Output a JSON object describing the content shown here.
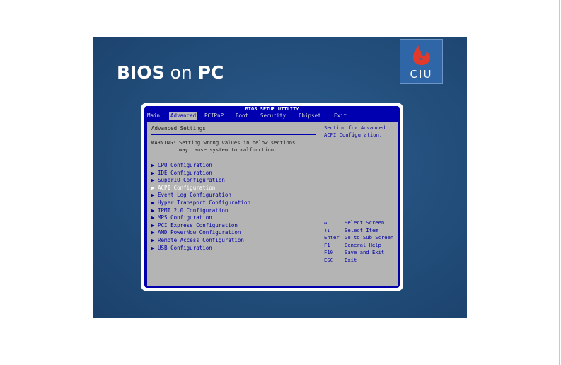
{
  "slide": {
    "title_bold_1": "BIOS",
    "title_mid": " on ",
    "title_bold_2": "PC",
    "logo_text": "CIU",
    "logo_icon": "flame-drop-icon",
    "colors": {
      "slide_bg": "#24507e",
      "logo_bg": "#2f66a8",
      "logo_mark": "#e23a2a"
    }
  },
  "bios": {
    "utility_title": "BIOS SETUP UTILITY",
    "menu": [
      "Main",
      "Advanced",
      "PCIPnP",
      "Boot",
      "Security",
      "Chipset",
      "Exit"
    ],
    "active_menu": "Advanced",
    "section_title": "Advanced Settings",
    "warning": "WARNING: Setting wrong values in below sections\n         may cause system to malfunction.",
    "items": [
      "▶ CPU Configuration",
      "▶ IDE Configuration",
      "▶ SuperIO Configuration",
      "▶ ACPI Configuration",
      "▶ Event Log Configuration",
      "▶ Hyper Transport Configuration",
      "▶ IPMI 2.0 Configuration",
      "▶ MPS Configuration",
      "▶ PCI Express Configuration",
      "▶ AMD PowerNow Configuration",
      "▶ Remote Access Configuration",
      "▶ USB Configuration"
    ],
    "selected_item": "▶ ACPI Configuration",
    "help_text": "Section for Advanced ACPI Configuration.",
    "keys": [
      {
        "key": "↔",
        "desc": "Select Screen"
      },
      {
        "key": "↑↓",
        "desc": "Select Item"
      },
      {
        "key": "Enter",
        "desc": "Go to Sub Screen"
      },
      {
        "key": "F1",
        "desc": "General Help"
      },
      {
        "key": "F10",
        "desc": "Save and Exit"
      },
      {
        "key": "ESC",
        "desc": "Exit"
      }
    ],
    "colors": {
      "bg_blue": "#0000b0",
      "panel_gray": "#b4b4b4",
      "text_blue": "#0000a0"
    }
  }
}
